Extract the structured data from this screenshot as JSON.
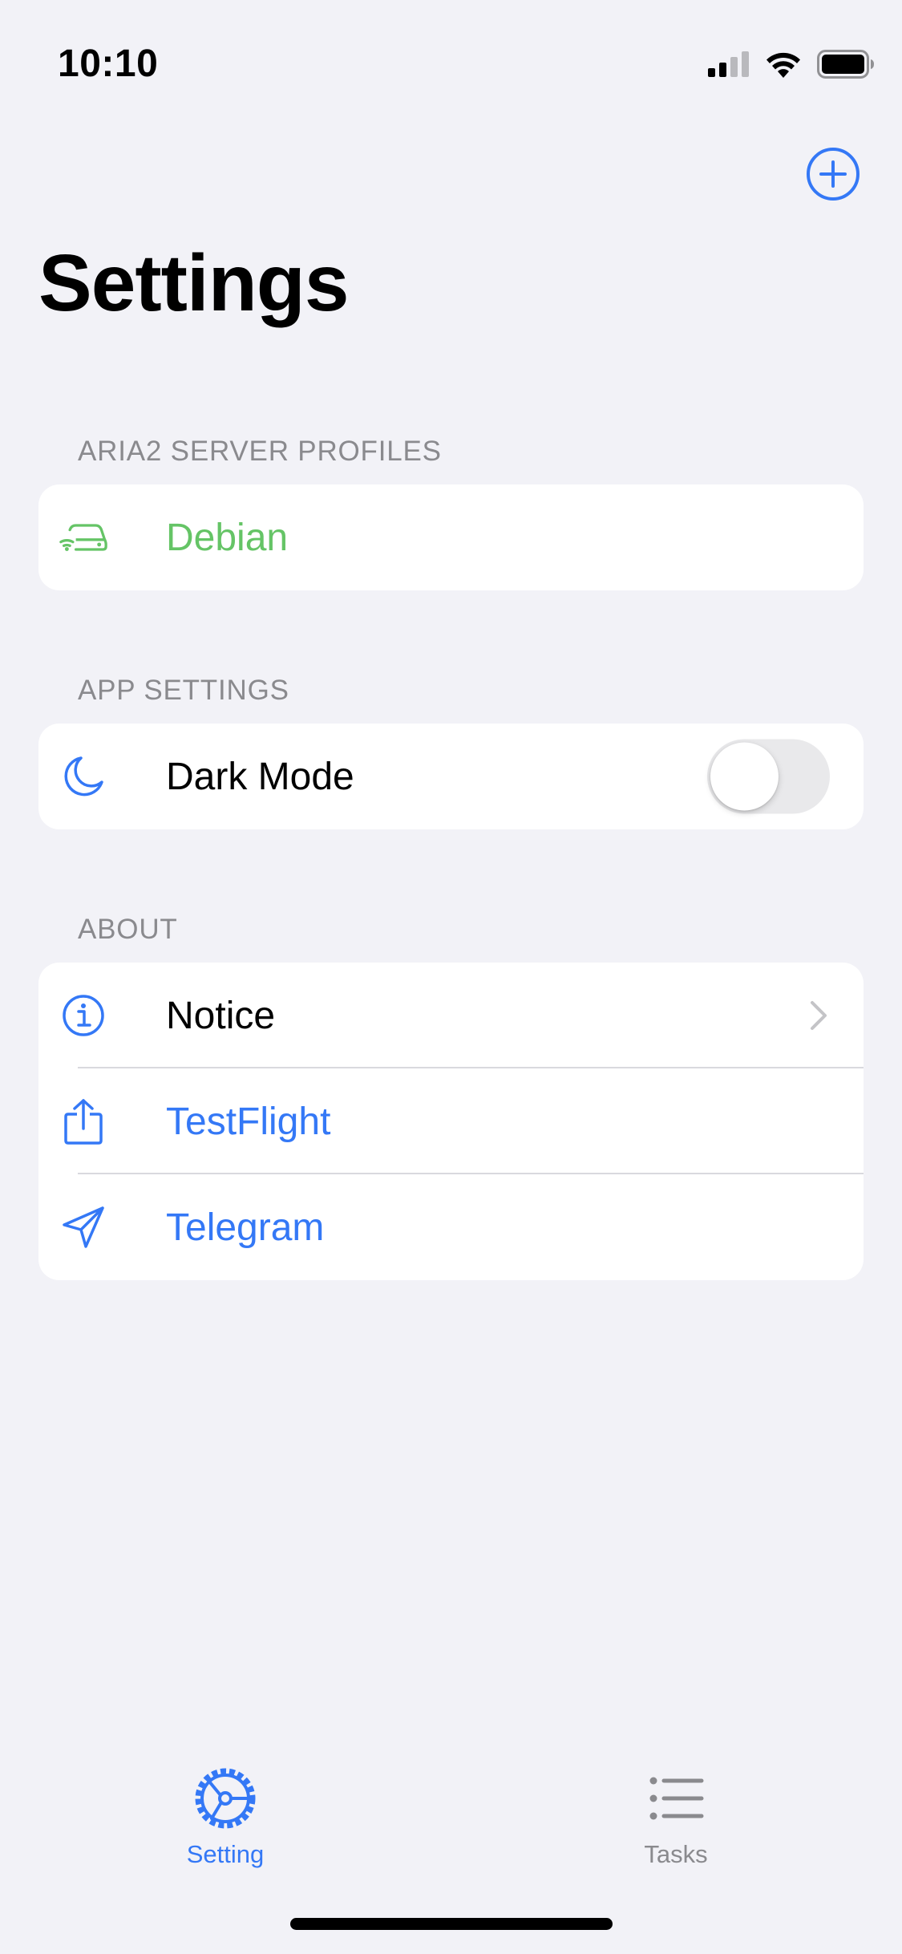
{
  "status_bar": {
    "time": "10:10"
  },
  "nav": {
    "title": "Settings"
  },
  "sections": {
    "servers": {
      "header": "ARIA2 SERVER PROFILES",
      "items": [
        {
          "label": "Debian"
        }
      ]
    },
    "app": {
      "header": "APP SETTINGS",
      "dark_mode": {
        "label": "Dark Mode",
        "enabled": false
      }
    },
    "about": {
      "header": "ABOUT",
      "items": [
        {
          "label": "Notice"
        },
        {
          "label": "TestFlight"
        },
        {
          "label": "Telegram"
        }
      ]
    }
  },
  "tab_bar": {
    "tabs": [
      {
        "label": "Setting",
        "icon": "steering-wheel-icon",
        "selected": true
      },
      {
        "label": "Tasks",
        "icon": "list-icon",
        "selected": false
      }
    ]
  },
  "colors": {
    "accent": "#3478f6",
    "server_green": "#65c466",
    "secondary": "#8a8a8e",
    "background": "#f2f2f7"
  }
}
